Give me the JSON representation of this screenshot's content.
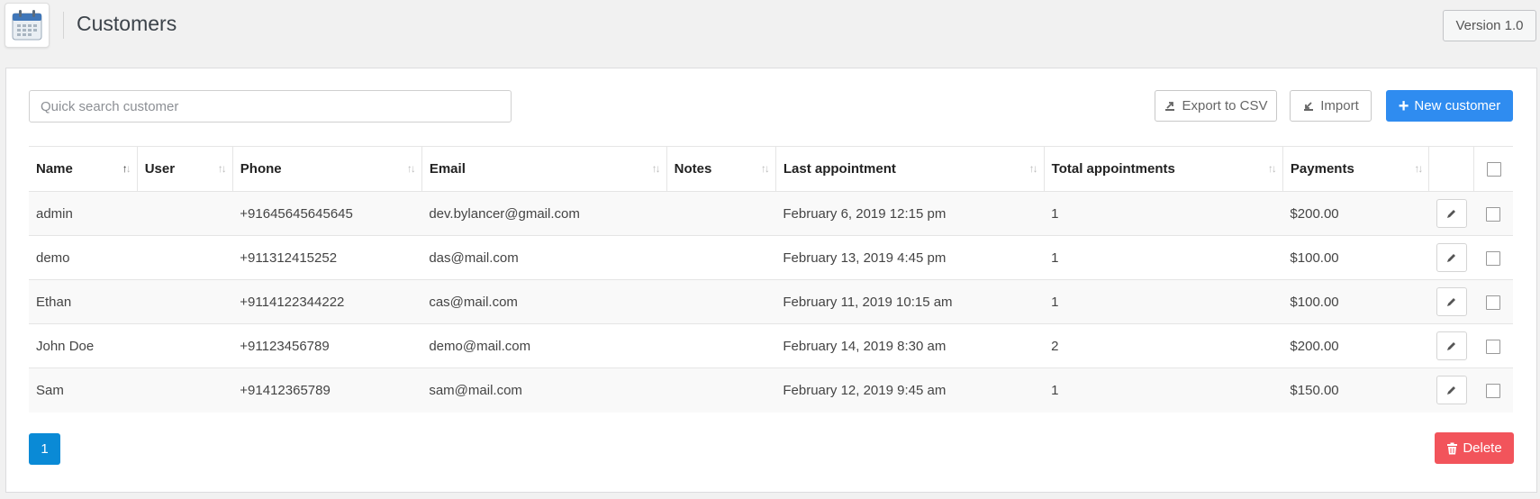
{
  "header": {
    "title": "Customers",
    "version": "Version 1.0",
    "app_icon": "calendar-icon"
  },
  "toolbar": {
    "search_placeholder": "Quick search customer",
    "search_value": "",
    "export_label": "Export to CSV",
    "import_label": "Import",
    "new_label": "New customer"
  },
  "table": {
    "columns": [
      "Name",
      "User",
      "Phone",
      "Email",
      "Notes",
      "Last appointment",
      "Total appointments",
      "Payments"
    ],
    "rows": [
      {
        "name": "admin",
        "user": "",
        "phone": "+91645645645645",
        "email": "dev.bylancer@gmail.com",
        "notes": "",
        "last": "February 6, 2019 12:15 pm",
        "total": "1",
        "payments": "$200.00"
      },
      {
        "name": "demo",
        "user": "",
        "phone": "+911312415252",
        "email": "das@mail.com",
        "notes": "",
        "last": "February 13, 2019 4:45 pm",
        "total": "1",
        "payments": "$100.00"
      },
      {
        "name": "Ethan",
        "user": "",
        "phone": "+9114122344222",
        "email": "cas@mail.com",
        "notes": "",
        "last": "February 11, 2019 10:15 am",
        "total": "1",
        "payments": "$100.00"
      },
      {
        "name": "John Doe",
        "user": "",
        "phone": "+91123456789",
        "email": "demo@mail.com",
        "notes": "",
        "last": "February 14, 2019 8:30 am",
        "total": "2",
        "payments": "$200.00"
      },
      {
        "name": "Sam",
        "user": "",
        "phone": "+91412365789",
        "email": "sam@mail.com",
        "notes": "",
        "last": "February 12, 2019 9:45 am",
        "total": "1",
        "payments": "$150.00"
      }
    ]
  },
  "pagination": {
    "current_page": "1"
  },
  "footer": {
    "delete_label": "Delete"
  },
  "colors": {
    "primary": "#2f8cf0",
    "page": "#0a8ad6",
    "danger": "#f2545b",
    "background": "#f1f1f1"
  }
}
